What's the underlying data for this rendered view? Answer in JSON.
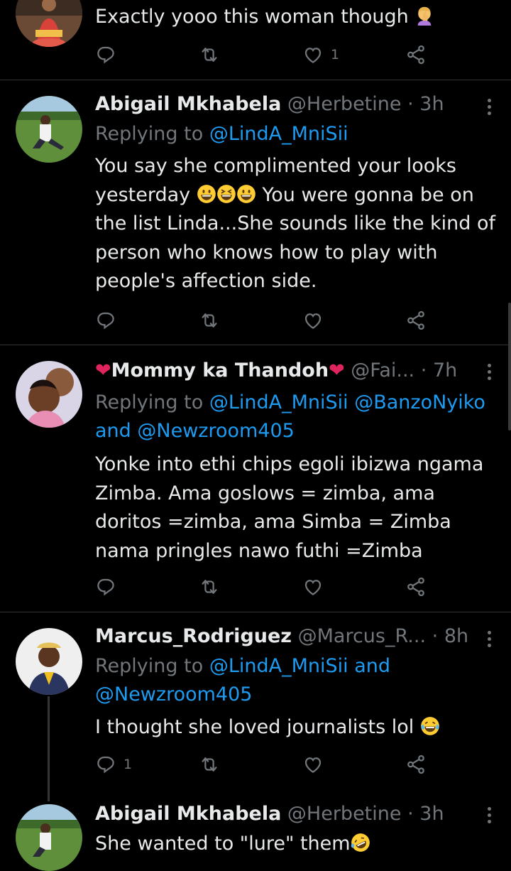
{
  "tweets": [
    {
      "text": "Exactly yooo this woman though",
      "reply_count": "",
      "like_count": "1"
    },
    {
      "name": "Abigail Mkhabela",
      "handle": "@Herbetine",
      "time": "3h",
      "replying_label": "Replying to",
      "mentions": "@LindA_MniSii",
      "text_part1": "You say she complimented your looks yesterday",
      "text_part2": "You were gonna be on the list Linda...She sounds like the kind of person who knows how to play with people's affection side.",
      "like_count": ""
    },
    {
      "name": "Mommy ka Thandoh",
      "handle": "@Fai...",
      "time": "7h",
      "replying_label": "Replying to",
      "mentions": "@LindA_MniSii @BanzoNyiko",
      "and": "and",
      "mentions2": "@Newzroom405",
      "text": "Yonke into ethi chips egoli ibizwa ngama Zimba. Ama goslows = zimba, ama doritos =zimba, ama Simba = Zimba nama pringles nawo futhi =Zimba"
    },
    {
      "name": "Marcus_Rodriguez",
      "handle": "@Marcus_R...",
      "time": "8h",
      "replying_label": "Replying to",
      "mentions": "@LindA_MniSii",
      "and": "and",
      "mentions2": "@Newzroom405",
      "text": "I thought she loved journalists lol",
      "reply_count": "1"
    },
    {
      "name": "Abigail Mkhabela",
      "handle": "@Herbetine",
      "time": "3h",
      "text": "She wanted to \"lure\" them"
    }
  ],
  "dot": "·",
  "icons": [
    "reply-icon",
    "retweet-icon",
    "like-icon",
    "share-icon",
    "more-icon"
  ],
  "colors": {
    "background": "#000000",
    "text": "#e7e9ea",
    "muted": "#71767b",
    "link": "#1d9bf0",
    "heart": "#e0245e"
  }
}
